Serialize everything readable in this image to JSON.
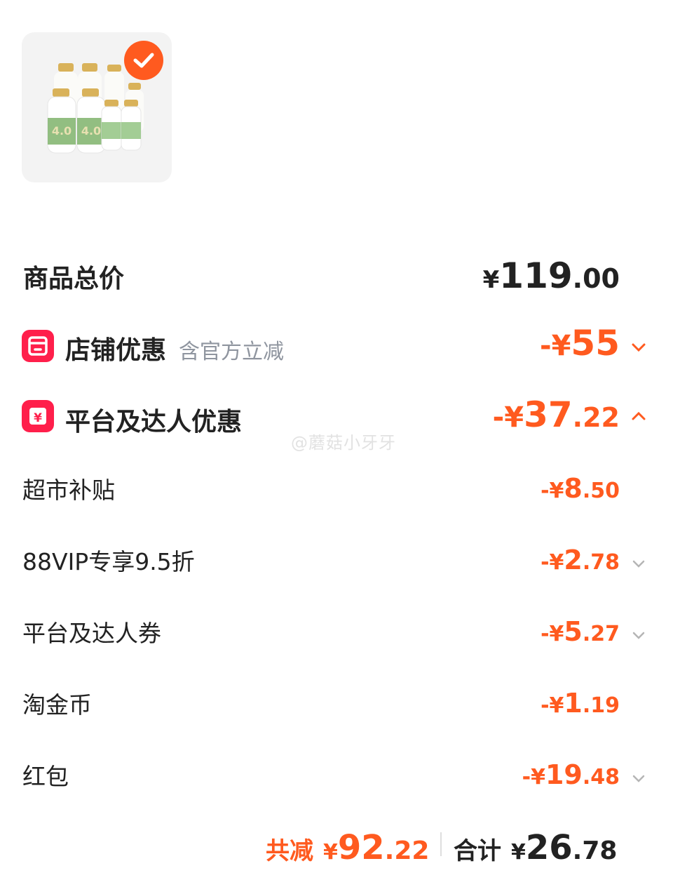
{
  "product": {
    "image_alt": "milk bottles bundle",
    "selected": true
  },
  "total_price": {
    "label": "商品总价",
    "currency": "¥",
    "int": "119",
    "dec": ".00"
  },
  "store_discount": {
    "label": "店铺优惠",
    "note": "含官方立减",
    "amount_prefix": "-¥",
    "int": "55",
    "dec": ""
  },
  "platform_discount": {
    "label": "平台及达人优惠",
    "amount_prefix": "-¥",
    "int": "37",
    "dec": ".22",
    "expanded": true
  },
  "watermark": "@蘑菇小牙牙",
  "discount_items": [
    {
      "label": "超市补贴",
      "prefix": "-¥",
      "int": "8",
      "dec": ".50",
      "has_chevron": false
    },
    {
      "label": "88VIP专享9.5折",
      "prefix": "-¥",
      "int": "2",
      "dec": ".78",
      "has_chevron": true
    },
    {
      "label": "平台及达人券",
      "prefix": "-¥",
      "int": "5",
      "dec": ".27",
      "has_chevron": true
    },
    {
      "label": "淘金币",
      "prefix": "-¥",
      "int": "1",
      "dec": ".19",
      "has_chevron": false
    },
    {
      "label": "红包",
      "prefix": "-¥",
      "int": "19",
      "dec": ".48",
      "has_chevron": true
    }
  ],
  "footer": {
    "saved_label": "共减",
    "saved_currency": "¥",
    "saved_int": "92",
    "saved_dec": ".22",
    "total_label": "合计",
    "total_currency": "¥",
    "total_int": "26",
    "total_dec": ".78"
  },
  "colors": {
    "accent": "#ff5a1f",
    "badge": "#ff1f4b",
    "text": "#222222",
    "muted": "#8f959f"
  }
}
